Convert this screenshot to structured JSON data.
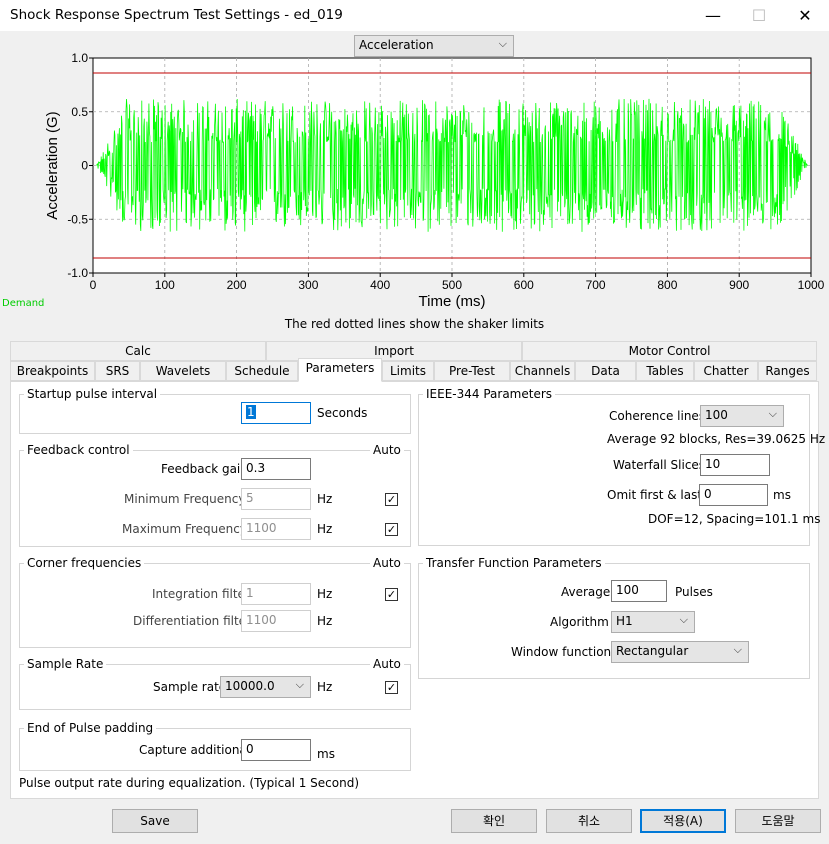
{
  "window": {
    "title": "Shock Response Spectrum Test Settings - ed_019",
    "minimize_icon": "minimize-icon",
    "maximize_icon": "maximize-icon",
    "close_icon": "close-icon",
    "minimize_glyph": "—",
    "maximize_glyph": "☐",
    "close_glyph": "✕"
  },
  "plot_selector": {
    "value": "Acceleration"
  },
  "chart_data": {
    "type": "line",
    "title": "",
    "xlabel": "Time (ms)",
    "ylabel": "Acceleration (G)",
    "xlim": [
      0,
      1000
    ],
    "ylim": [
      -1.0,
      1.0
    ],
    "xticks": [
      "0",
      "100",
      "200",
      "300",
      "400",
      "500",
      "600",
      "700",
      "800",
      "900",
      "1000"
    ],
    "yticks": [
      "1.0",
      "0.5",
      "0",
      "-0.5",
      "-1.0"
    ],
    "grid": true,
    "series": [
      {
        "name": "Demand",
        "color": "#00ff00",
        "description_envelope_peak": 0.62,
        "x_range": [
          5,
          995
        ]
      }
    ],
    "limit_lines": [
      {
        "value": 0.86,
        "color": "#c00000"
      },
      {
        "value": -0.86,
        "color": "#c00000"
      }
    ]
  },
  "chart_legend_label": "Demand",
  "chart_note": "The red dotted lines show the shaker limits",
  "tabs_row1": [
    "Calc",
    "Import",
    "Motor Control"
  ],
  "tabs_row2": [
    "Breakpoints",
    "SRS",
    "Wavelets",
    "Schedule",
    "Parameters",
    "Limits",
    "Pre-Test",
    "Channels",
    "Data",
    "Tables",
    "Chatter",
    "Ranges"
  ],
  "active_tab": "Parameters",
  "startup": {
    "title": "Startup pulse interval",
    "value": "1",
    "unit": "Seconds"
  },
  "feedback": {
    "title": "Feedback control",
    "auto_label": "Auto",
    "gain_label": "Feedback gain",
    "gain_value": "0.3",
    "min_label": "Minimum Frequency",
    "min_value": "5",
    "min_unit": "Hz",
    "max_label": "Maximum Frequency",
    "max_value": "1100",
    "max_unit": "Hz",
    "check_glyph": "✓"
  },
  "corner": {
    "title": "Corner frequencies",
    "auto_label": "Auto",
    "int_label": "Integration filter",
    "int_value": "1",
    "int_unit": "Hz",
    "diff_label": "Differentiation filter",
    "diff_value": "1100",
    "diff_unit": "Hz"
  },
  "sample": {
    "title": "Sample Rate",
    "auto_label": "Auto",
    "rate_label": "Sample rate",
    "rate_value": "10000.0",
    "rate_unit": "Hz"
  },
  "padding": {
    "title": "End of Pulse padding",
    "capture_label": "Capture additional",
    "capture_value": "0",
    "capture_unit": "ms"
  },
  "footer_note": "Pulse output rate during equalization. (Typical 1 Second)",
  "ieee": {
    "title": "IEEE-344 Parameters",
    "coherence_label": "Coherence lines",
    "coherence_value": "100",
    "avg_info": "Average 92 blocks, Res=39.0625 Hz",
    "waterfall_label": "Waterfall Slices",
    "waterfall_value": "10",
    "omit_label": "Omit first & last",
    "omit_value": "0",
    "omit_unit": "ms",
    "dof_info": "DOF=12, Spacing=101.1 ms"
  },
  "transfer": {
    "title": "Transfer Function Parameters",
    "average_label": "Average",
    "average_value": "100",
    "average_unit": "Pulses",
    "algorithm_label": "Algorithm",
    "algorithm_value": "H1",
    "window_label": "Window function",
    "window_value": "Rectangular"
  },
  "buttons": {
    "save": "Save",
    "ok": "확인",
    "cancel": "취소",
    "apply": "적용(A)",
    "help": "도움말"
  },
  "dropdown_glyph": "⌵"
}
